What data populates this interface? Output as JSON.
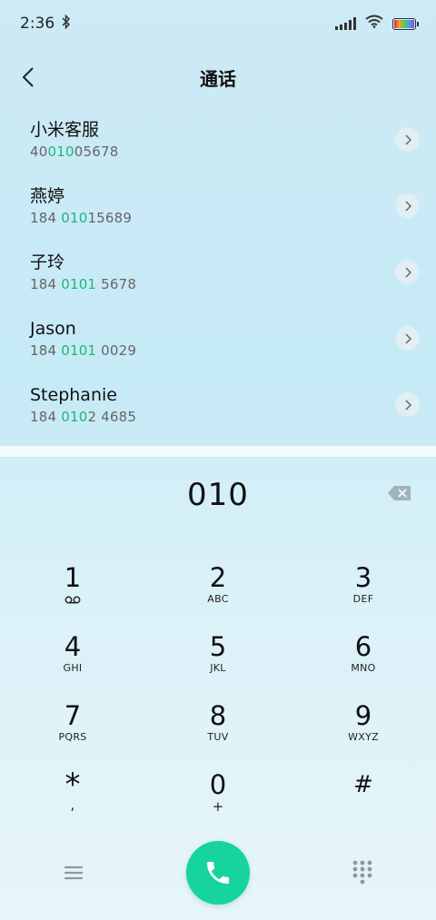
{
  "status_bar": {
    "time": "2:36",
    "battery_level": 1.0
  },
  "header": {
    "title": "通话"
  },
  "contacts": [
    {
      "name": "小米客服",
      "number_pre": "40",
      "number_match": "010",
      "number_post": "05678"
    },
    {
      "name": "燕婷",
      "number_pre": "184 ",
      "number_match": "010",
      "number_post": "15689"
    },
    {
      "name": "子玲",
      "number_pre": "184 ",
      "number_match": "0101",
      "number_post": " 5678"
    },
    {
      "name": "Jason",
      "number_pre": "184 ",
      "number_match": "0101",
      "number_post": " 0029"
    },
    {
      "name": "Stephanie",
      "number_pre": "184 ",
      "number_match": "010",
      "number_post": "2 4685"
    }
  ],
  "colors": {
    "match_highlight": "#21b57a",
    "call_button": "#17d39d"
  },
  "dialer": {
    "input_value": "010",
    "keys": [
      [
        {
          "digit": "1",
          "letters": "",
          "icon": "voicemail-icon"
        },
        {
          "digit": "2",
          "letters": "ABC"
        },
        {
          "digit": "3",
          "letters": "DEF"
        }
      ],
      [
        {
          "digit": "4",
          "letters": "GHI"
        },
        {
          "digit": "5",
          "letters": "JKL"
        },
        {
          "digit": "6",
          "letters": "MNO"
        }
      ],
      [
        {
          "digit": "7",
          "letters": "PQRS"
        },
        {
          "digit": "8",
          "letters": "TUV"
        },
        {
          "digit": "9",
          "letters": "WXYZ"
        }
      ],
      [
        {
          "digit": "*",
          "letters": ","
        },
        {
          "digit": "0",
          "letters": "+"
        },
        {
          "digit": "#",
          "letters": ""
        }
      ]
    ]
  },
  "icons": {
    "back": "chevron-left-icon",
    "detail": "chevron-right-icon",
    "backspace": "backspace-icon",
    "menu": "menu-icon",
    "call": "phone-icon",
    "keypad": "dialpad-icon"
  }
}
